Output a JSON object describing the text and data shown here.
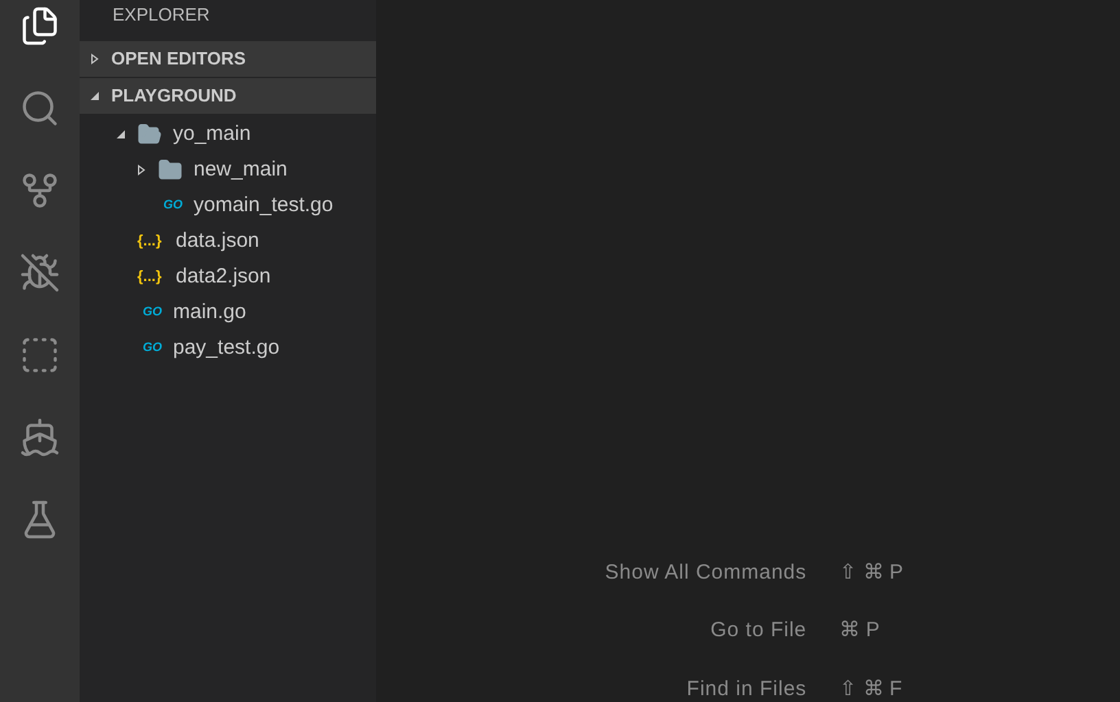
{
  "activity_bar": [
    {
      "kind": "files",
      "selected": true
    },
    {
      "kind": "search",
      "selected": false
    },
    {
      "kind": "source-control",
      "selected": false
    },
    {
      "kind": "debug",
      "selected": false
    },
    {
      "kind": "extensions",
      "selected": false
    },
    {
      "kind": "docker",
      "selected": false
    },
    {
      "kind": "test",
      "selected": false
    }
  ],
  "sidebar": {
    "title": "EXPLORER",
    "sections": [
      {
        "label": "OPEN EDITORS",
        "expanded": false
      },
      {
        "label": "PLAYGROUND",
        "expanded": true,
        "items": [
          {
            "name": "yo_main",
            "kind": "folder",
            "expanded": true,
            "children": [
              {
                "name": "new_main",
                "kind": "folder",
                "expanded": false
              },
              {
                "name": "yomain_test.go",
                "kind": "go",
                "icon": "GO"
              }
            ]
          },
          {
            "name": "data.json",
            "kind": "json",
            "icon": "{...}"
          },
          {
            "name": "data2.json",
            "kind": "json",
            "icon": "{...}"
          },
          {
            "name": "main.go",
            "kind": "go",
            "icon": "GO"
          },
          {
            "name": "pay_test.go",
            "kind": "go",
            "icon": "GO"
          }
        ]
      }
    ]
  },
  "editor": {
    "shortcuts": [
      {
        "label": "Show All Commands",
        "keys": "⇧ ⌘ P"
      },
      {
        "label": "Go to File",
        "keys": "⌘ P"
      },
      {
        "label": "Find in Files",
        "keys": "⇧ ⌘ F"
      }
    ]
  }
}
